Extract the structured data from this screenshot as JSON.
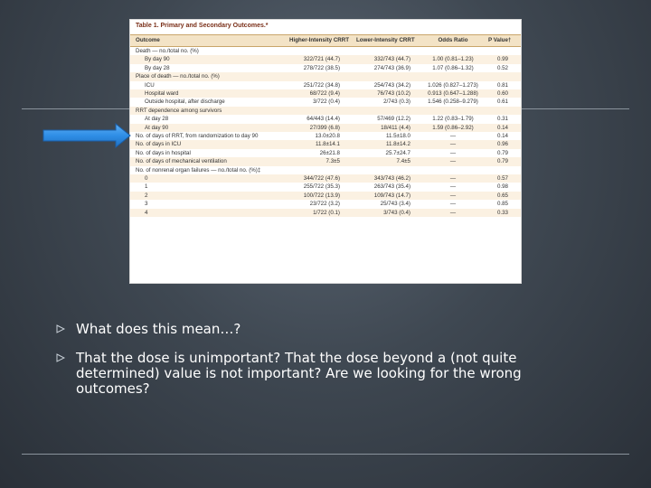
{
  "table": {
    "title": "Table 1. Primary and Secondary Outcomes.*",
    "columns": [
      "Outcome",
      "Higher-Intensity CRRT",
      "Lower-Intensity CRRT",
      "Odds Ratio",
      "P Value†"
    ],
    "rows": [
      {
        "label": "Death — no./total no. (%)",
        "indent": false,
        "cells": [
          "",
          "",
          "",
          ""
        ]
      },
      {
        "label": "By day 90",
        "indent": true,
        "cells": [
          "322/721 (44.7)",
          "332/743 (44.7)",
          "1.00 (0.81–1.23)",
          "0.99"
        ]
      },
      {
        "label": "By day 28",
        "indent": true,
        "cells": [
          "278/722 (38.5)",
          "274/743 (36.9)",
          "1.07 (0.86–1.32)",
          "0.52"
        ]
      },
      {
        "label": "Place of death — no./total no. (%)",
        "indent": false,
        "cells": [
          "",
          "",
          "",
          ""
        ]
      },
      {
        "label": "ICU",
        "indent": true,
        "cells": [
          "251/722 (34.8)",
          "254/743 (34.2)",
          "1.026 (0.827–1.273)",
          "0.81"
        ]
      },
      {
        "label": "Hospital ward",
        "indent": true,
        "cells": [
          "68/722 (9.4)",
          "76/743 (10.2)",
          "0.913 (0.647–1.288)",
          "0.60"
        ]
      },
      {
        "label": "Outside hospital, after discharge",
        "indent": true,
        "cells": [
          "3/722 (0.4)",
          "2/743 (0.3)",
          "1.546 (0.258–9.279)",
          "0.61"
        ]
      },
      {
        "label": "RRT dependence among survivors",
        "indent": false,
        "cells": [
          "",
          "",
          "",
          ""
        ]
      },
      {
        "label": "At day 28",
        "indent": true,
        "cells": [
          "64/443 (14.4)",
          "57/469 (12.2)",
          "1.22 (0.83–1.79)",
          "0.31"
        ]
      },
      {
        "label": "At day 90",
        "indent": true,
        "cells": [
          "27/399 (6.8)",
          "18/411 (4.4)",
          "1.59 (0.86–2.92)",
          "0.14"
        ]
      },
      {
        "label": "No. of days of RRT, from randomization to day 90",
        "indent": false,
        "cells": [
          "13.0±20.8",
          "11.5±18.0",
          "—",
          "0.14"
        ]
      },
      {
        "label": "No. of days in ICU",
        "indent": false,
        "cells": [
          "11.8±14.1",
          "11.8±14.2",
          "—",
          "0.96"
        ]
      },
      {
        "label": "No. of days in hospital",
        "indent": false,
        "cells": [
          "26±21.8",
          "25.7±24.7",
          "—",
          "0.79"
        ]
      },
      {
        "label": "No. of days of mechanical ventilation",
        "indent": false,
        "cells": [
          "7.3±5",
          "7.4±5",
          "—",
          "0.79"
        ]
      },
      {
        "label": "No. of nonrenal organ failures — no./total no. (%)‡",
        "indent": false,
        "cells": [
          "",
          "",
          "",
          ""
        ]
      },
      {
        "label": "0",
        "indent": true,
        "cells": [
          "344/722 (47.6)",
          "343/743 (46.2)",
          "—",
          "0.57"
        ]
      },
      {
        "label": "1",
        "indent": true,
        "cells": [
          "255/722 (35.3)",
          "263/743 (35.4)",
          "—",
          "0.98"
        ]
      },
      {
        "label": "2",
        "indent": true,
        "cells": [
          "100/722 (13.9)",
          "109/743 (14.7)",
          "—",
          "0.65"
        ]
      },
      {
        "label": "3",
        "indent": true,
        "cells": [
          "23/722 (3.2)",
          "25/743 (3.4)",
          "—",
          "0.85"
        ]
      },
      {
        "label": "4",
        "indent": true,
        "cells": [
          "1/722 (0.1)",
          "3/743 (0.4)",
          "—",
          "0.33"
        ]
      }
    ]
  },
  "bullets": [
    "What does this mean…?",
    "That the dose is unimportant? That the dose beyond a (not quite determined) value is not important? Are we looking for the wrong outcomes?"
  ],
  "colors": {
    "arrow": "#2f8ee6",
    "header_band": "#f3e3c6",
    "title_text": "#7a2f18"
  }
}
